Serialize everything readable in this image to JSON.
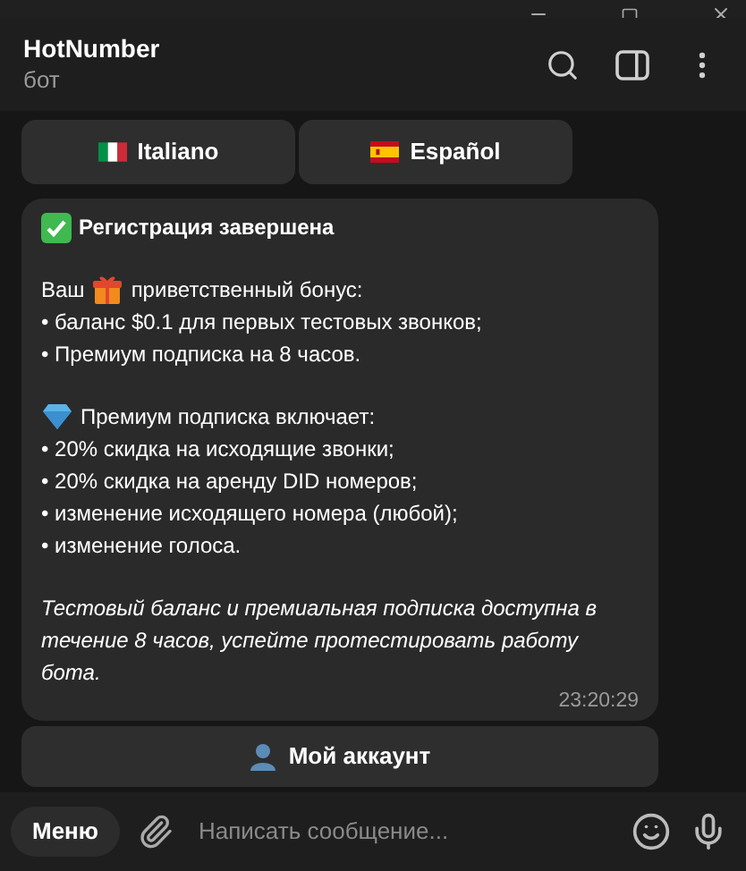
{
  "header": {
    "title": "HotNumber",
    "subtitle": "бот"
  },
  "top_buttons": [
    {
      "label": "Italiano",
      "kind": "italy"
    },
    {
      "label": "Español",
      "kind": "spain"
    }
  ],
  "message": {
    "heading": "Регистрация завершена",
    "paragraphs": [
      [
        {
          "kind": "gift",
          "prefix": "Ваш",
          "text": "приветственный бонус:"
        },
        {
          "kind": "plain",
          "text": "• баланс $0.1 для первых тестовых звонков;"
        },
        {
          "kind": "plain",
          "text": "• Премиум подписка на 8 часов."
        }
      ],
      [
        {
          "kind": "diamond",
          "text": "Премиум подписка включает:"
        },
        {
          "kind": "plain",
          "text": "• 20% скидка на исходящие звонки;"
        },
        {
          "kind": "plain",
          "text": "• 20% скидка на аренду DID номеров;"
        },
        {
          "kind": "plain",
          "text": "• изменение исходящего номера (любой);"
        },
        {
          "kind": "plain",
          "text": "• изменение голоса."
        }
      ]
    ],
    "note": "Тестовый баланс и премиальная подписка доступна в течение 8 часов, успейте протестировать работу бота.",
    "time": "23:20:29"
  },
  "account_button": {
    "label": "Мой аккаунт"
  },
  "composer": {
    "menu": "Меню",
    "placeholder": "Написать сообщение..."
  }
}
